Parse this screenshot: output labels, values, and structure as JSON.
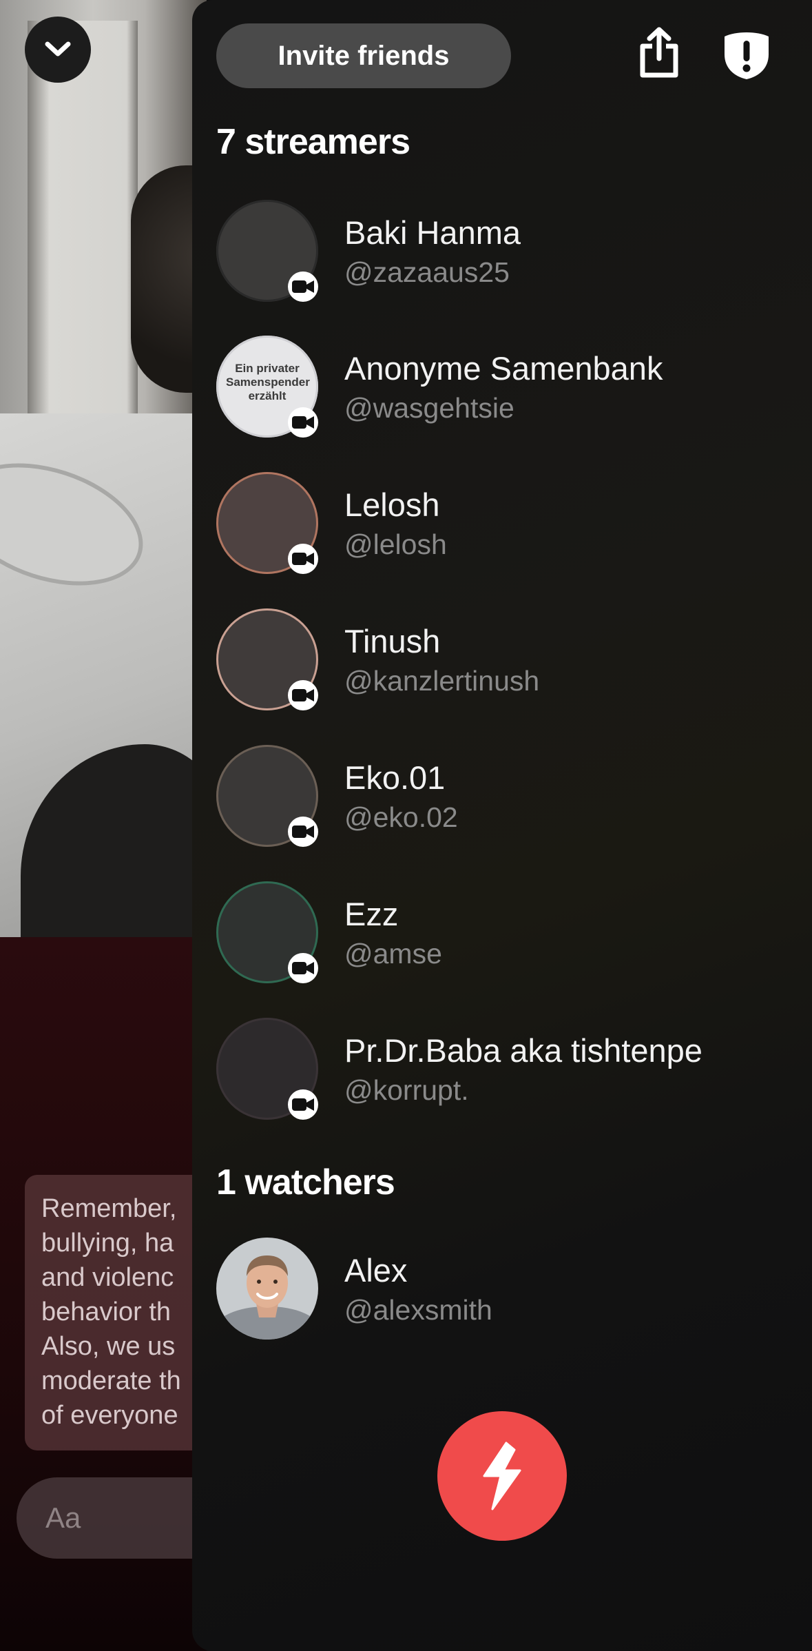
{
  "header": {
    "invite_label": "Invite friends",
    "share_icon": "share-icon",
    "report_icon": "report-icon"
  },
  "streamers": {
    "title": "7 streamers",
    "items": [
      {
        "name": "Baki Hanma",
        "handle": "@zazaaus25",
        "avatar_color": "#3b3a39",
        "ring": "#2a2a2a"
      },
      {
        "name": "Anonyme Samenbank",
        "handle": "@wasgehtsie",
        "avatar_color": "#e6e6e8",
        "ring": "#cfcfd3",
        "avatar_text": "Ein privater Samenspender erzählt"
      },
      {
        "name": "Lelosh",
        "handle": "@lelosh",
        "avatar_color": "#4e4241",
        "ring": "#b07560"
      },
      {
        "name": "Tinush",
        "handle": "@kanzlertinush",
        "avatar_color": "#403b3a",
        "ring": "#c9a092"
      },
      {
        "name": "Eko.01",
        "handle": "@eko.02",
        "avatar_color": "#3a3837",
        "ring": "#6b5f55"
      },
      {
        "name": "Ezz",
        "handle": "@amse",
        "avatar_color": "#2f3230",
        "ring": "#2f6a52"
      },
      {
        "name": "Pr.Dr.Baba aka tishtenpe",
        "handle": "@korrupt.",
        "avatar_color": "#2d2a2c",
        "ring": "#3a3336"
      }
    ]
  },
  "watchers": {
    "title": "1 watchers",
    "items": [
      {
        "name": "Alex",
        "handle": "@alexsmith"
      }
    ]
  },
  "notice": {
    "text": "Remember,\nbullying, ha\nand violenc\nbehavior th\nAlso, we us\nmoderate th\nof everyone"
  },
  "composer": {
    "placeholder": "Aa"
  },
  "colors": {
    "accent": "#f04b4b",
    "invite_bg": "#4a4a4a",
    "handle_text": "#8a8a8a"
  }
}
